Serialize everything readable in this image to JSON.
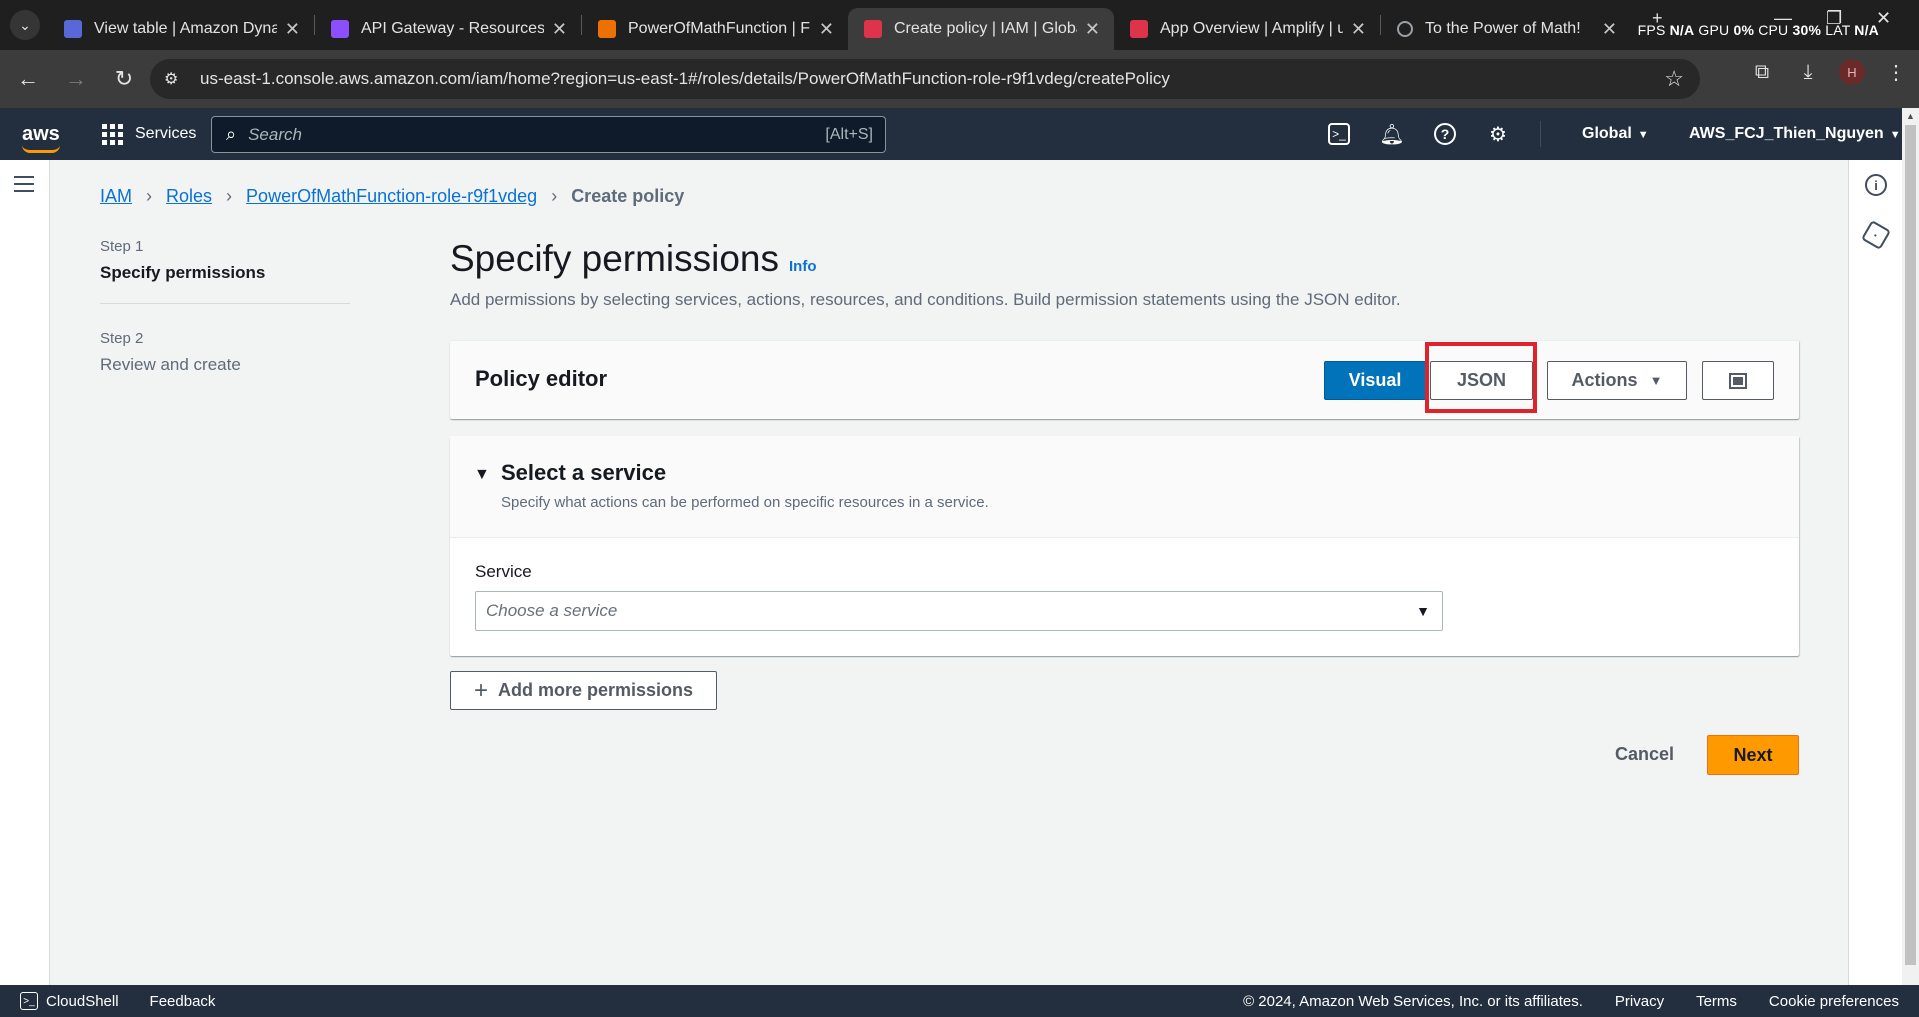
{
  "browser": {
    "tabs": [
      {
        "title": "View table | Amazon Dyna",
        "favicon_color": "#5a67d8"
      },
      {
        "title": "API Gateway - Resources",
        "favicon_color": "#8c4fff"
      },
      {
        "title": "PowerOfMathFunction | Fu",
        "favicon_color": "#ed7100"
      },
      {
        "title": "Create policy | IAM | Globa",
        "favicon_color": "#dd344c"
      },
      {
        "title": "App Overview | Amplify | u",
        "favicon_color": "#dd344c"
      },
      {
        "title": "To the Power of Math!",
        "favicon_color": "#5f6368"
      }
    ],
    "perf": {
      "fps_label": "FPS",
      "fps_value": "N/A",
      "gpu_label": "GPU",
      "gpu_value": "0",
      "gpu_unit": "%",
      "cpu_label": "CPU",
      "cpu_value": "30",
      "cpu_unit": "%",
      "lat_label": "LAT",
      "lat_value": "N/A"
    },
    "url": "us-east-1.console.aws.amazon.com/iam/home?region=us-east-1#/roles/details/PowerOfMathFunction-role-r9f1vdeg/createPolicy",
    "profile_initial": "H"
  },
  "aws_nav": {
    "logo": "aws",
    "services_label": "Services",
    "search_placeholder": "Search",
    "search_shortcut": "[Alt+S]",
    "region": "Global",
    "account": "AWS_FCJ_Thien_Nguyen"
  },
  "breadcrumb": {
    "items": [
      "IAM",
      "Roles",
      "PowerOfMathFunction-role-r9f1vdeg"
    ],
    "current": "Create policy"
  },
  "steps": [
    {
      "number": "Step 1",
      "name": "Specify permissions",
      "active": true
    },
    {
      "number": "Step 2",
      "name": "Review and create",
      "active": false
    }
  ],
  "main": {
    "title": "Specify permissions",
    "info_label": "Info",
    "description": "Add permissions by selecting services, actions, resources, and conditions. Build permission statements using the JSON editor."
  },
  "policy_editor": {
    "title": "Policy editor",
    "visual_label": "Visual",
    "json_label": "JSON",
    "actions_label": "Actions",
    "highlight_color": "#e0232a"
  },
  "select_service": {
    "title": "Select a service",
    "description": "Specify what actions can be performed on specific resources in a service.",
    "field_label": "Service",
    "placeholder": "Choose a service"
  },
  "add_more_label": "Add more permissions",
  "cancel_label": "Cancel",
  "next_label": "Next",
  "footer": {
    "cloudshell": "CloudShell",
    "feedback": "Feedback",
    "copyright": "© 2024, Amazon Web Services, Inc. or its affiliates.",
    "privacy": "Privacy",
    "terms": "Terms",
    "cookies": "Cookie preferences"
  },
  "colors": {
    "aws_nav_bg": "#232f3e",
    "primary_blue": "#0073bb",
    "next_orange": "#ff9900"
  }
}
